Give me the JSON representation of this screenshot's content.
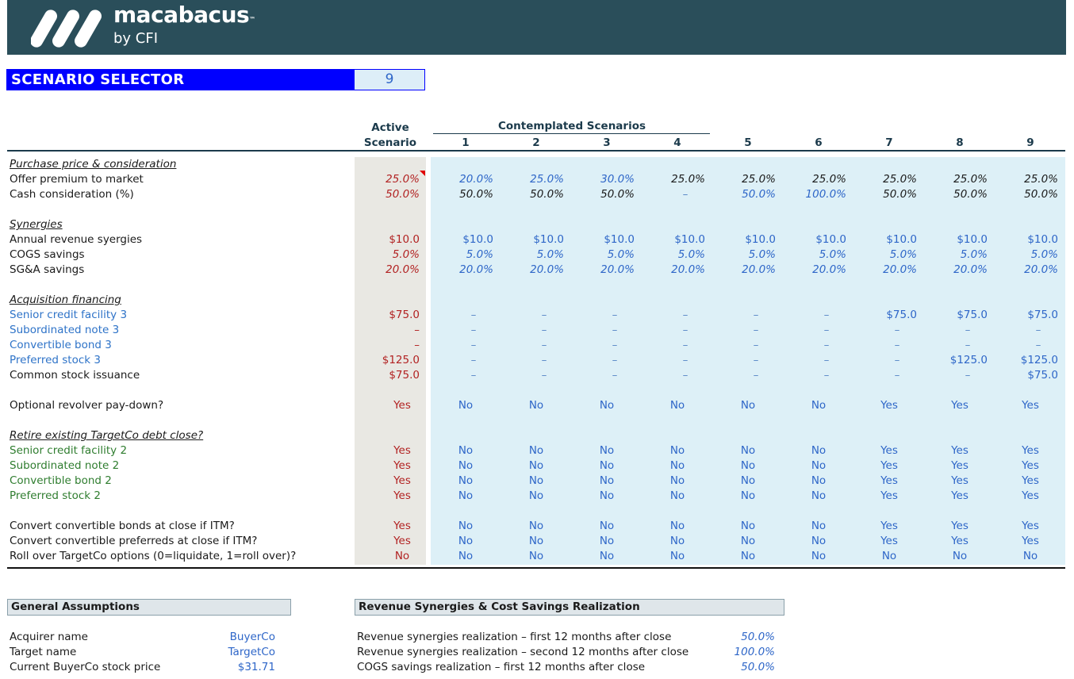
{
  "brand": {
    "name": "macabacus",
    "tm": "™",
    "sub": "by CFI"
  },
  "selector": {
    "label": "SCENARIO SELECTOR",
    "value": "9"
  },
  "headers": {
    "active": [
      "Active",
      "Scenario"
    ],
    "contemplated": "Contemplated Scenarios",
    "columns": [
      "1",
      "2",
      "3",
      "4",
      "5",
      "6",
      "7",
      "8",
      "9"
    ]
  },
  "sections": {
    "purchase": "Purchase price & consideration",
    "synergies": "Synergies",
    "financing": "Acquisition financing",
    "retire": "Retire existing TargetCo debt close?"
  },
  "rows": [
    {
      "key": "offer",
      "label": "Offer premium to market",
      "active": "25.0%",
      "vals": [
        "20.0%",
        "25.0%",
        "30.0%",
        "25.0%",
        "25.0%",
        "25.0%",
        "25.0%",
        "25.0%",
        "25.0%"
      ]
    },
    {
      "key": "cash",
      "label": "Cash consideration (%)",
      "active": "50.0%",
      "vals": [
        "50.0%",
        "50.0%",
        "50.0%",
        "–",
        "50.0%",
        "100.0%",
        "50.0%",
        "50.0%",
        "50.0%"
      ]
    },
    {
      "key": "rev",
      "label": "Annual revenue syergies",
      "active": "$10.0",
      "vals": [
        "$10.0",
        "$10.0",
        "$10.0",
        "$10.0",
        "$10.0",
        "$10.0",
        "$10.0",
        "$10.0",
        "$10.0"
      ]
    },
    {
      "key": "cogs",
      "label": "COGS savings",
      "active": "5.0%",
      "vals": [
        "5.0%",
        "5.0%",
        "5.0%",
        "5.0%",
        "5.0%",
        "5.0%",
        "5.0%",
        "5.0%",
        "5.0%"
      ]
    },
    {
      "key": "sga",
      "label": "SG&A savings",
      "active": "20.0%",
      "vals": [
        "20.0%",
        "20.0%",
        "20.0%",
        "20.0%",
        "20.0%",
        "20.0%",
        "20.0%",
        "20.0%",
        "20.0%"
      ]
    },
    {
      "key": "senior3",
      "label": "Senior credit facility 3",
      "active": "$75.0",
      "vals": [
        "–",
        "–",
        "–",
        "–",
        "–",
        "–",
        "$75.0",
        "$75.0",
        "$75.0"
      ]
    },
    {
      "key": "sub3",
      "label": "Subordinated note 3",
      "active": "–",
      "vals": [
        "–",
        "–",
        "–",
        "–",
        "–",
        "–",
        "–",
        "–",
        "–"
      ]
    },
    {
      "key": "conv3",
      "label": "Convertible bond 3",
      "active": "–",
      "vals": [
        "–",
        "–",
        "–",
        "–",
        "–",
        "–",
        "–",
        "–",
        "–"
      ]
    },
    {
      "key": "pref3",
      "label": "Preferred stock 3",
      "active": "$125.0",
      "vals": [
        "–",
        "–",
        "–",
        "–",
        "–",
        "–",
        "–",
        "$125.0",
        "$125.0"
      ]
    },
    {
      "key": "common",
      "label": "Common stock issuance",
      "active": "$75.0",
      "vals": [
        "–",
        "–",
        "–",
        "–",
        "–",
        "–",
        "–",
        "–",
        "$75.0"
      ]
    },
    {
      "key": "revolver",
      "label": "Optional revolver pay-down?",
      "active": "Yes",
      "vals": [
        "No",
        "No",
        "No",
        "No",
        "No",
        "No",
        "Yes",
        "Yes",
        "Yes"
      ]
    },
    {
      "key": "senior2",
      "label": "Senior credit facility 2",
      "active": "Yes",
      "vals": [
        "No",
        "No",
        "No",
        "No",
        "No",
        "No",
        "Yes",
        "Yes",
        "Yes"
      ]
    },
    {
      "key": "sub2",
      "label": "Subordinated note 2",
      "active": "Yes",
      "vals": [
        "No",
        "No",
        "No",
        "No",
        "No",
        "No",
        "Yes",
        "Yes",
        "Yes"
      ]
    },
    {
      "key": "conv2",
      "label": "Convertible bond 2",
      "active": "Yes",
      "vals": [
        "No",
        "No",
        "No",
        "No",
        "No",
        "No",
        "Yes",
        "Yes",
        "Yes"
      ]
    },
    {
      "key": "pref2",
      "label": "Preferred stock 2",
      "active": "Yes",
      "vals": [
        "No",
        "No",
        "No",
        "No",
        "No",
        "No",
        "Yes",
        "Yes",
        "Yes"
      ]
    },
    {
      "key": "convbonds",
      "label": "Convert convertible bonds at close if ITM?",
      "active": "Yes",
      "vals": [
        "No",
        "No",
        "No",
        "No",
        "No",
        "No",
        "Yes",
        "Yes",
        "Yes"
      ]
    },
    {
      "key": "convprefs",
      "label": "Convert convertible preferreds at close if ITM?",
      "active": "Yes",
      "vals": [
        "No",
        "No",
        "No",
        "No",
        "No",
        "No",
        "Yes",
        "Yes",
        "Yes"
      ]
    },
    {
      "key": "rollover",
      "label": "Roll over TargetCo options (0=liquidate, 1=roll over)?",
      "active": "No",
      "vals": [
        "No",
        "No",
        "No",
        "No",
        "No",
        "No",
        "No",
        "No",
        "No"
      ]
    }
  ],
  "general": {
    "title": "General Assumptions",
    "items": [
      {
        "label": "Acquirer name",
        "value": "BuyerCo"
      },
      {
        "label": "Target name",
        "value": "TargetCo"
      },
      {
        "label": "Current BuyerCo stock price",
        "value": "$31.71"
      }
    ]
  },
  "realization": {
    "title": "Revenue Synergies & Cost Savings Realization",
    "items": [
      {
        "label": "Revenue synergies realization – first 12 months after close",
        "value": "50.0%"
      },
      {
        "label": "Revenue synergies realization – second 12 months after close",
        "value": "100.0%"
      },
      {
        "label": "COGS savings realization – first 12 months after close",
        "value": "50.0%"
      }
    ]
  },
  "colors": {
    "banner": "#2a4e5a",
    "selector": "#0000ff",
    "active_text": "#b22222",
    "input_blue": "#2e66c8"
  }
}
